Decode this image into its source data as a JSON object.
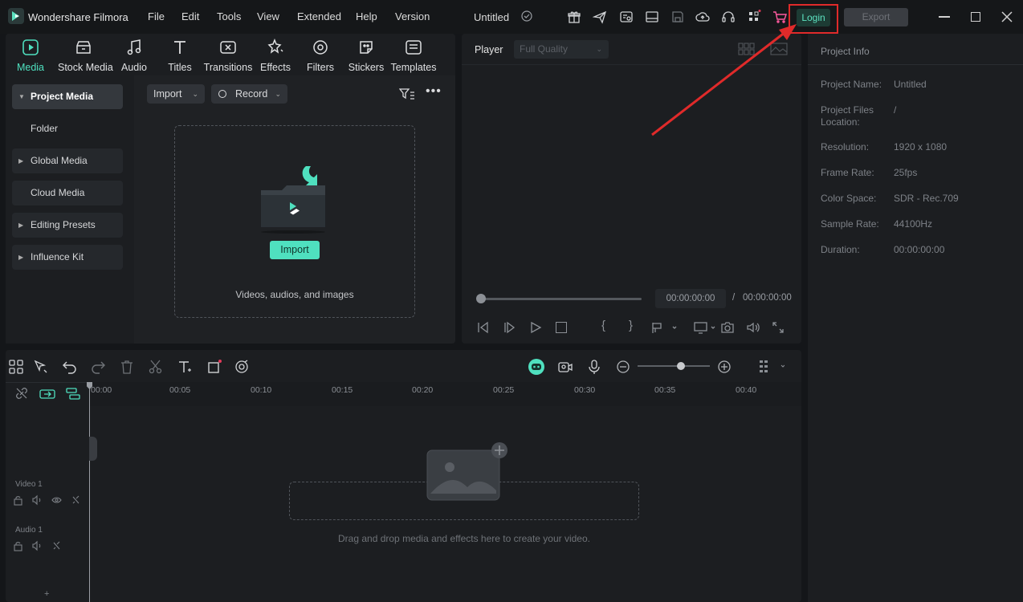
{
  "app": {
    "name": "Wondershare Filmora",
    "doc_title": "Untitled"
  },
  "menu": [
    "File",
    "Edit",
    "Tools",
    "View",
    "Extended",
    "Help",
    "Version"
  ],
  "header": {
    "login_label": "Login",
    "export_label": "Export"
  },
  "media_tabs": [
    "Media",
    "Stock Media",
    "Audio",
    "Titles",
    "Transitions",
    "Effects",
    "Filters",
    "Stickers",
    "Templates"
  ],
  "sidebar": {
    "items": [
      "Project Media",
      "Folder",
      "Global Media",
      "Cloud Media",
      "Editing Presets",
      "Influence Kit"
    ]
  },
  "media": {
    "import_label": "Import",
    "record_label": "Record",
    "drop_button": "Import",
    "drop_hint": "Videos, audios, and images"
  },
  "player": {
    "label": "Player",
    "quality": "Full Quality",
    "current_time": "00:00:00:00",
    "separator": "/",
    "total_time": "00:00:00:00"
  },
  "project_info": {
    "title": "Project Info",
    "rows": [
      {
        "key": "Project Name:",
        "value": "Untitled"
      },
      {
        "key": "Project Files Location:",
        "value": "/"
      },
      {
        "key": "Resolution:",
        "value": "1920 x 1080"
      },
      {
        "key": "Frame Rate:",
        "value": "25fps"
      },
      {
        "key": "Color Space:",
        "value": "SDR - Rec.709"
      },
      {
        "key": "Sample Rate:",
        "value": "44100Hz"
      },
      {
        "key": "Duration:",
        "value": "00:00:00:00"
      }
    ]
  },
  "timeline": {
    "ruler": [
      "00:00",
      "00:05",
      "00:10",
      "00:15",
      "00:20",
      "00:25",
      "00:30",
      "00:35",
      "00:40"
    ],
    "tracks": [
      "Video 1",
      "Audio 1"
    ],
    "drop_hint": "Drag and drop media and effects here to create your video.",
    "add_track": "+"
  },
  "colors": {
    "accent": "#4fe0bf",
    "highlight_box": "#e02a2a",
    "arrow": "#e02a2a"
  }
}
